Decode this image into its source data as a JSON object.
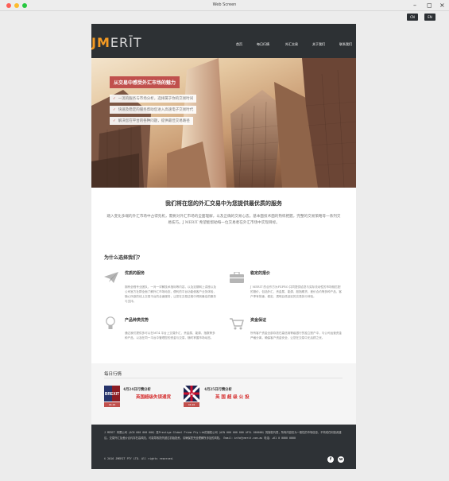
{
  "window": {
    "title": "Web Screen",
    "min_icon": "minimize-icon",
    "max_icon": "maximize-icon",
    "close_icon": "close-icon"
  },
  "toolbar": {
    "btn1": "CN",
    "btn2": "EN"
  },
  "header": {
    "logo_accent": "JM",
    "logo_rest": "ERĪT",
    "nav": [
      "首页",
      "每日行情",
      "外汇交易",
      "关于我们",
      "联系我们"
    ]
  },
  "hero": {
    "title": "从交易中感受外汇市场的魅力",
    "items": [
      "一流的服务与市场分析，选择属于你的交易时间",
      "快速及稳定的服务帮助您进入高速电子交易时代",
      "解决您在平台的各种问题，提供最佳交易路径"
    ]
  },
  "intro": {
    "headline": "我们将在您的外汇交易中为您提供最优质的服务",
    "text": "踏入变化多端的外汇市场中占得先机，需要对外汇市场的全面理解，以及正确的交易心态。基本面技术面的熟练把握，完整的交易策略等一系列交易技巧。J MERIT 希望能帮助每一位交易者在外汇市场中实现目标。"
  },
  "why": {
    "title": "为什么选择我们？",
    "features": [
      {
        "icon": "paper-plane-icon",
        "title": "优质的服务",
        "desc": "拥有全程专业团队，一对一详解技术指标等内容，以及定期网上讲座以及公司官方社群全面了解外汇市场动态，便利的平台功能使客户业务体验，随心所欲的线上交易平台的全面服务，让您在交易过程中得到最佳的服务与支持。"
      },
      {
        "icon": "briefcase-icon",
        "title": "稳定的报价",
        "desc": "J MERIT 的合作方为FXPRO 共同提供给您与实际流动性的市场相匹配的报价，包括外汇、贵金属、能源、股指期货、差价合约等多种产品，客户享有快速、稳定、透明且低延迟的交易执行体验。"
      },
      {
        "icon": "lightbulb-icon",
        "title": "产品种类优势",
        "desc": "通过我们提供多可以在MT4 平台上交易外汇、贵金属、能源、指数等多种产品，以及在同一平台中管理您的资金与交易，随时掌握市场动态。"
      },
      {
        "icon": "cart-icon",
        "title": "资金保证",
        "desc": "所有客户资金全部存放在高信用等级银行的独立账户中，与公司运营资金严格分离，确保客户资金安全，让您在交易中无后顾之忧。"
      }
    ]
  },
  "daily": {
    "title": "每日行情",
    "articles": [
      {
        "title": "4月24日行情分析",
        "subtitle": "英国超级失误通货",
        "tag": "04.26",
        "thumb_text": "BREXIT"
      },
      {
        "title": "4月25日行情分析",
        "subtitle": "英 国 超 级 公 投",
        "tag": "04.26",
        "thumb_text": "UK"
      }
    ]
  },
  "footer": {
    "text": "J MERIT 有限公司（ACN 000 000 000）是Prestige Global Prime Pty Ltd的授权公司（ACN 000 000 000 AFSL 000000）的授权代表，所有内容仅为一般性的市场信息，不构成任何投资建议。交易外汇及差价合约存在高风险，可能导致损失超过初始投资。请确保您完全理解所涉及的风险。 Email：info@jmerit.com.au 电话：+61 0 0000 0000",
    "copyright": "© 2016 JMERIT PTY LTD. All rights reserved.",
    "social": [
      "facebook-icon",
      "weibo-icon"
    ]
  }
}
